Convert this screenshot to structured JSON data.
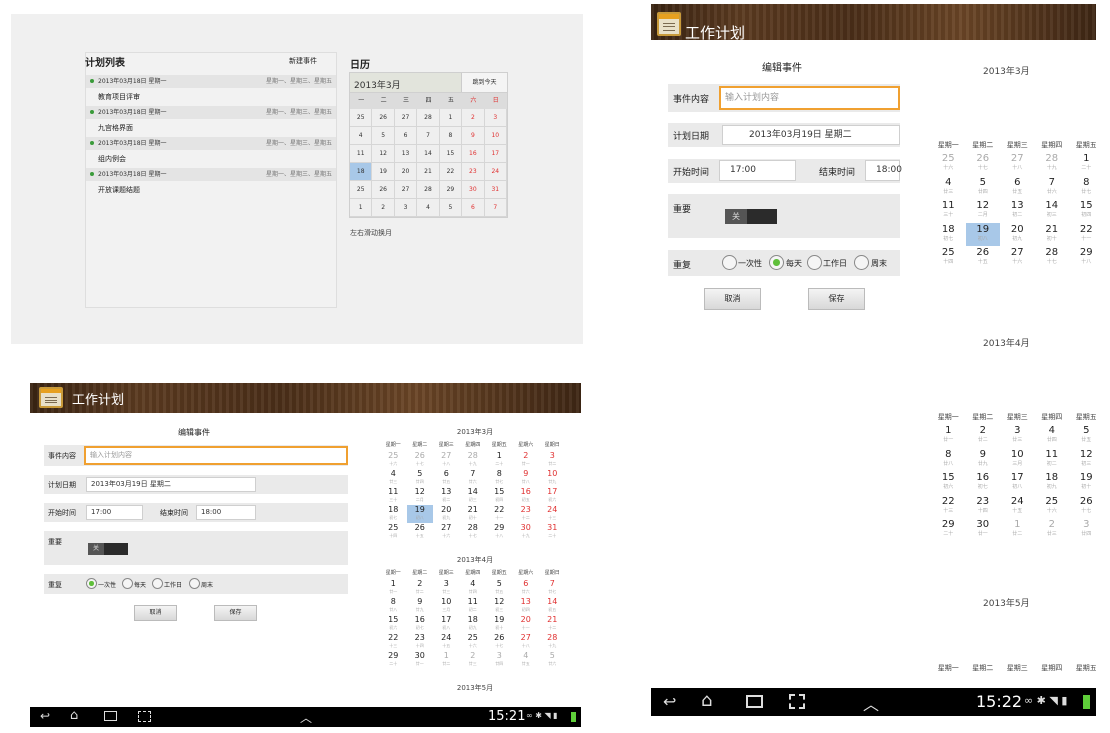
{
  "plan_list": {
    "title": "计划列表",
    "new_event": "新建事件",
    "items": [
      {
        "date": "2013年03月18日 星期一",
        "repeat": "星期一、星期三、星期五",
        "content": "教育项目评审"
      },
      {
        "date": "2013年03月18日 星期一",
        "repeat": "星期一、星期三、星期五",
        "content": "九宫格界面"
      },
      {
        "date": "2013年03月18日 星期一",
        "repeat": "星期一、星期三、星期五",
        "content": "组内例会"
      },
      {
        "date": "2013年03月18日 星期一",
        "repeat": "星期一、星期三、星期五",
        "content": "开放课题结题"
      }
    ]
  },
  "calendar_panel": {
    "title": "日历",
    "month": "2013年3月",
    "today_button": "跳到今天",
    "weekdays": [
      "一",
      "二",
      "三",
      "四",
      "五",
      "六",
      "日"
    ],
    "days": [
      "25",
      "26",
      "27",
      "28",
      "1",
      "2",
      "3",
      "4",
      "5",
      "6",
      "7",
      "8",
      "9",
      "10",
      "11",
      "12",
      "13",
      "14",
      "15",
      "16",
      "17",
      "18",
      "19",
      "20",
      "21",
      "22",
      "23",
      "24",
      "25",
      "26",
      "27",
      "28",
      "29",
      "30",
      "31",
      "1",
      "2",
      "3",
      "4",
      "5",
      "6",
      "7"
    ],
    "swipe_hint": "左右滑动换月"
  },
  "app": {
    "name": "工作计划"
  },
  "edit_form": {
    "title": "编辑事件",
    "content_label": "事件内容",
    "content_placeholder": "输入计划内容",
    "date_label": "计划日期",
    "date_value": "2013年03月19日 星期二",
    "start_label": "开始时间",
    "start_value": "17:00",
    "end_label": "结束时间",
    "end_value": "18:00",
    "important_label": "重要",
    "toggle_text": "关",
    "repeat_label": "重复",
    "repeat_options": [
      "一次性",
      "每天",
      "工作日",
      "周末"
    ],
    "cancel": "取消",
    "save": "保存"
  },
  "big_calendar": {
    "weekdays": [
      "星期一",
      "星期二",
      "星期三",
      "星期四",
      "星期五",
      "星期六",
      "星期日"
    ],
    "months": [
      {
        "title": "2013年3月",
        "days": [
          "25",
          "26",
          "27",
          "28",
          "1",
          "2",
          "3",
          "4",
          "5",
          "6",
          "7",
          "8",
          "9",
          "10",
          "11",
          "12",
          "13",
          "14",
          "15",
          "16",
          "17",
          "18",
          "19",
          "20",
          "21",
          "22",
          "23",
          "24",
          "25",
          "26",
          "27",
          "28",
          "29",
          "30",
          "31"
        ],
        "lunar": [
          "十六",
          "十七",
          "十八",
          "十九",
          "二十",
          "廿一",
          "廿二",
          "廿三",
          "廿四",
          "廿五",
          "廿六",
          "廿七",
          "廿八",
          "廿九",
          "三十",
          "二月",
          "初二",
          "初三",
          "初四",
          "初五",
          "初六",
          "初七",
          "初八",
          "初九",
          "初十",
          "十一",
          "十二",
          "十三",
          "十四",
          "十五",
          "十六",
          "十七",
          "十八",
          "十九",
          "二十"
        ]
      },
      {
        "title": "2013年4月",
        "days": [
          "1",
          "2",
          "3",
          "4",
          "5",
          "6",
          "7",
          "8",
          "9",
          "10",
          "11",
          "12",
          "13",
          "14",
          "15",
          "16",
          "17",
          "18",
          "19",
          "20",
          "21",
          "22",
          "23",
          "24",
          "25",
          "26",
          "27",
          "28",
          "29",
          "30",
          "1",
          "2",
          "3",
          "4",
          "5"
        ],
        "lunar": [
          "廿一",
          "廿二",
          "廿三",
          "廿四",
          "廿五",
          "廿六",
          "廿七",
          "廿八",
          "廿九",
          "三月",
          "初二",
          "初三",
          "初四",
          "初五",
          "初六",
          "初七",
          "初八",
          "初九",
          "初十",
          "十一",
          "十二",
          "十三",
          "十四",
          "十五",
          "十六",
          "十七",
          "十八",
          "十九",
          "二十",
          "廿一",
          "廿二",
          "廿三",
          "廿四",
          "廿五",
          "廿六"
        ]
      },
      {
        "title": "2013年5月"
      }
    ]
  },
  "narrow_calendar": {
    "weekdays": [
      "星期一",
      "星期二",
      "星期三",
      "星期四",
      "星期五"
    ],
    "march_days": [
      "25",
      "26",
      "27",
      "28",
      "1",
      "4",
      "5",
      "6",
      "7",
      "8",
      "11",
      "12",
      "13",
      "14",
      "15",
      "18",
      "19",
      "20",
      "21",
      "22",
      "25",
      "26",
      "27",
      "28",
      "29"
    ],
    "march_lunar": [
      "十六",
      "十七",
      "十八",
      "十九",
      "二十",
      "廿三",
      "廿四",
      "廿五",
      "廿六",
      "廿七",
      "三十",
      "二月",
      "初二",
      "初三",
      "初四",
      "初七",
      "初八",
      "初九",
      "初十",
      "十一",
      "十四",
      "十五",
      "十六",
      "十七",
      "十八"
    ],
    "april_days": [
      "1",
      "2",
      "3",
      "4",
      "5",
      "8",
      "9",
      "10",
      "11",
      "12",
      "15",
      "16",
      "17",
      "18",
      "19",
      "22",
      "23",
      "24",
      "25",
      "26",
      "29",
      "30",
      "1",
      "2",
      "3"
    ],
    "april_lunar": [
      "廿一",
      "廿二",
      "廿三",
      "廿四",
      "廿五",
      "廿八",
      "廿九",
      "三月",
      "初二",
      "初三",
      "初六",
      "初七",
      "初八",
      "初九",
      "初十",
      "十三",
      "十四",
      "十五",
      "十六",
      "十七",
      "二十",
      "廿一",
      "廿二",
      "廿三",
      "廿四"
    ]
  },
  "status_bar_small": {
    "time": "15:21"
  },
  "status_bar_large": {
    "time": "15:22"
  },
  "colors": {
    "selected_day": "#a8c8e8",
    "weekend_red": "#e03030",
    "focus_orange": "#f0a030",
    "radio_green": "#5fbf3a"
  },
  "icons": [
    "back-icon",
    "home-icon",
    "recent-apps-icon",
    "screenshot-icon",
    "up-chevron-icon",
    "wifi-icon",
    "bluetooth-icon",
    "signal-icon",
    "battery-icon",
    "notebook-app-icon"
  ]
}
